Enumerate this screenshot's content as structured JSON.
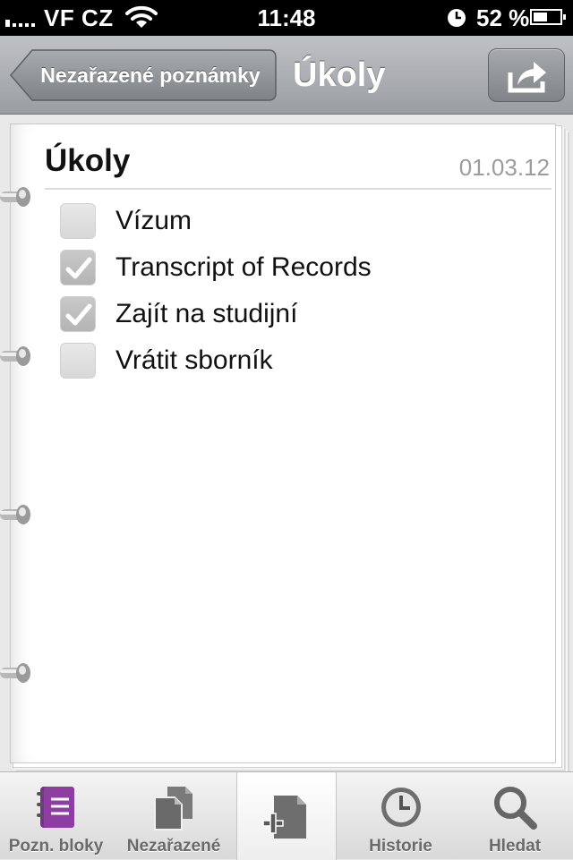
{
  "status_bar": {
    "carrier": "VF CZ",
    "time": "11:48",
    "battery_percent": "52 %",
    "battery_level": 0.52,
    "icons": [
      "signal-icon",
      "wifi-icon",
      "alarm-clock-icon",
      "battery-icon"
    ]
  },
  "nav": {
    "back_label": "Nezařazené poznámky",
    "title": "Úkoly",
    "share_icon": "share-icon"
  },
  "note": {
    "title": "Úkoly",
    "date": "01.03.12",
    "tasks": [
      {
        "text": "Vízum",
        "checked": false
      },
      {
        "text": "Transcript of Records",
        "checked": true
      },
      {
        "text": "Zajít na studijní",
        "checked": true
      },
      {
        "text": "Vrátit sborník",
        "checked": false
      }
    ]
  },
  "tabs": [
    {
      "label": "Pozn. bloky",
      "icon": "notebook-icon",
      "accent": "#7b2f8e"
    },
    {
      "label": "Nezařazené",
      "icon": "documents-icon"
    },
    {
      "label": "",
      "icon": "new-note-icon"
    },
    {
      "label": "Historie",
      "icon": "clock-icon"
    },
    {
      "label": "Hledat",
      "icon": "search-icon"
    }
  ]
}
